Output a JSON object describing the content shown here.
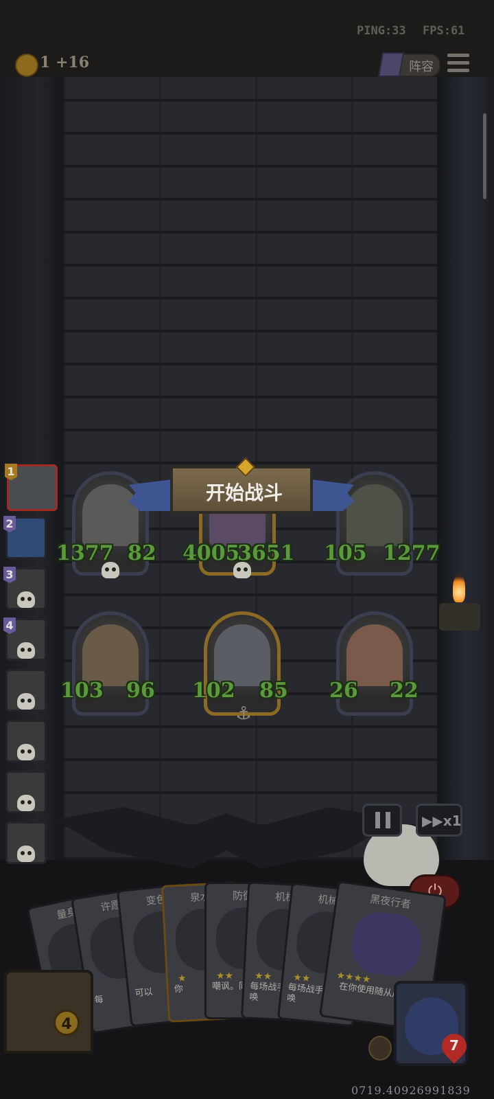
{
  "hud": {
    "ping": "PING:33",
    "fps": "FPS:61",
    "coins": "1 +16",
    "lineup_label": "阵容"
  },
  "battle": {
    "start_button_label": "开始战斗",
    "enemies": [
      {
        "attack": "1377",
        "health": "82"
      },
      {
        "attack": "4005",
        "health": "3651"
      },
      {
        "attack": "105",
        "health": "1277"
      }
    ],
    "allies": [
      {
        "attack": "103",
        "health": "96"
      },
      {
        "attack": "102",
        "health": "85"
      },
      {
        "attack": "26",
        "health": "22"
      }
    ]
  },
  "players": {
    "tiers": [
      "1",
      "2",
      "3",
      "4"
    ]
  },
  "controls": {
    "speed_label": "▶▶x1"
  },
  "hand": [
    {
      "name": "量身",
      "text": ""
    },
    {
      "name": "许愿",
      "text": "每"
    },
    {
      "name": "变色",
      "text": "可以"
    },
    {
      "name": "泉水",
      "text": "你"
    },
    {
      "name": "防御",
      "text": "嘲讽。同于"
    },
    {
      "name": "机械",
      "text": "每场战手牌中召唤"
    },
    {
      "name": "机械",
      "text": "每场战手牌中召唤"
    },
    {
      "name": "黑夜行者",
      "text": "在你使用随从后"
    }
  ],
  "bottom": {
    "chest_count": "4",
    "hero_health": "7",
    "footer_code": "0719.40926991839"
  },
  "colors": {
    "stat_green": "#5a9a3d",
    "ribbon_blue": "#3e5592",
    "active_border": "#a12a22"
  }
}
